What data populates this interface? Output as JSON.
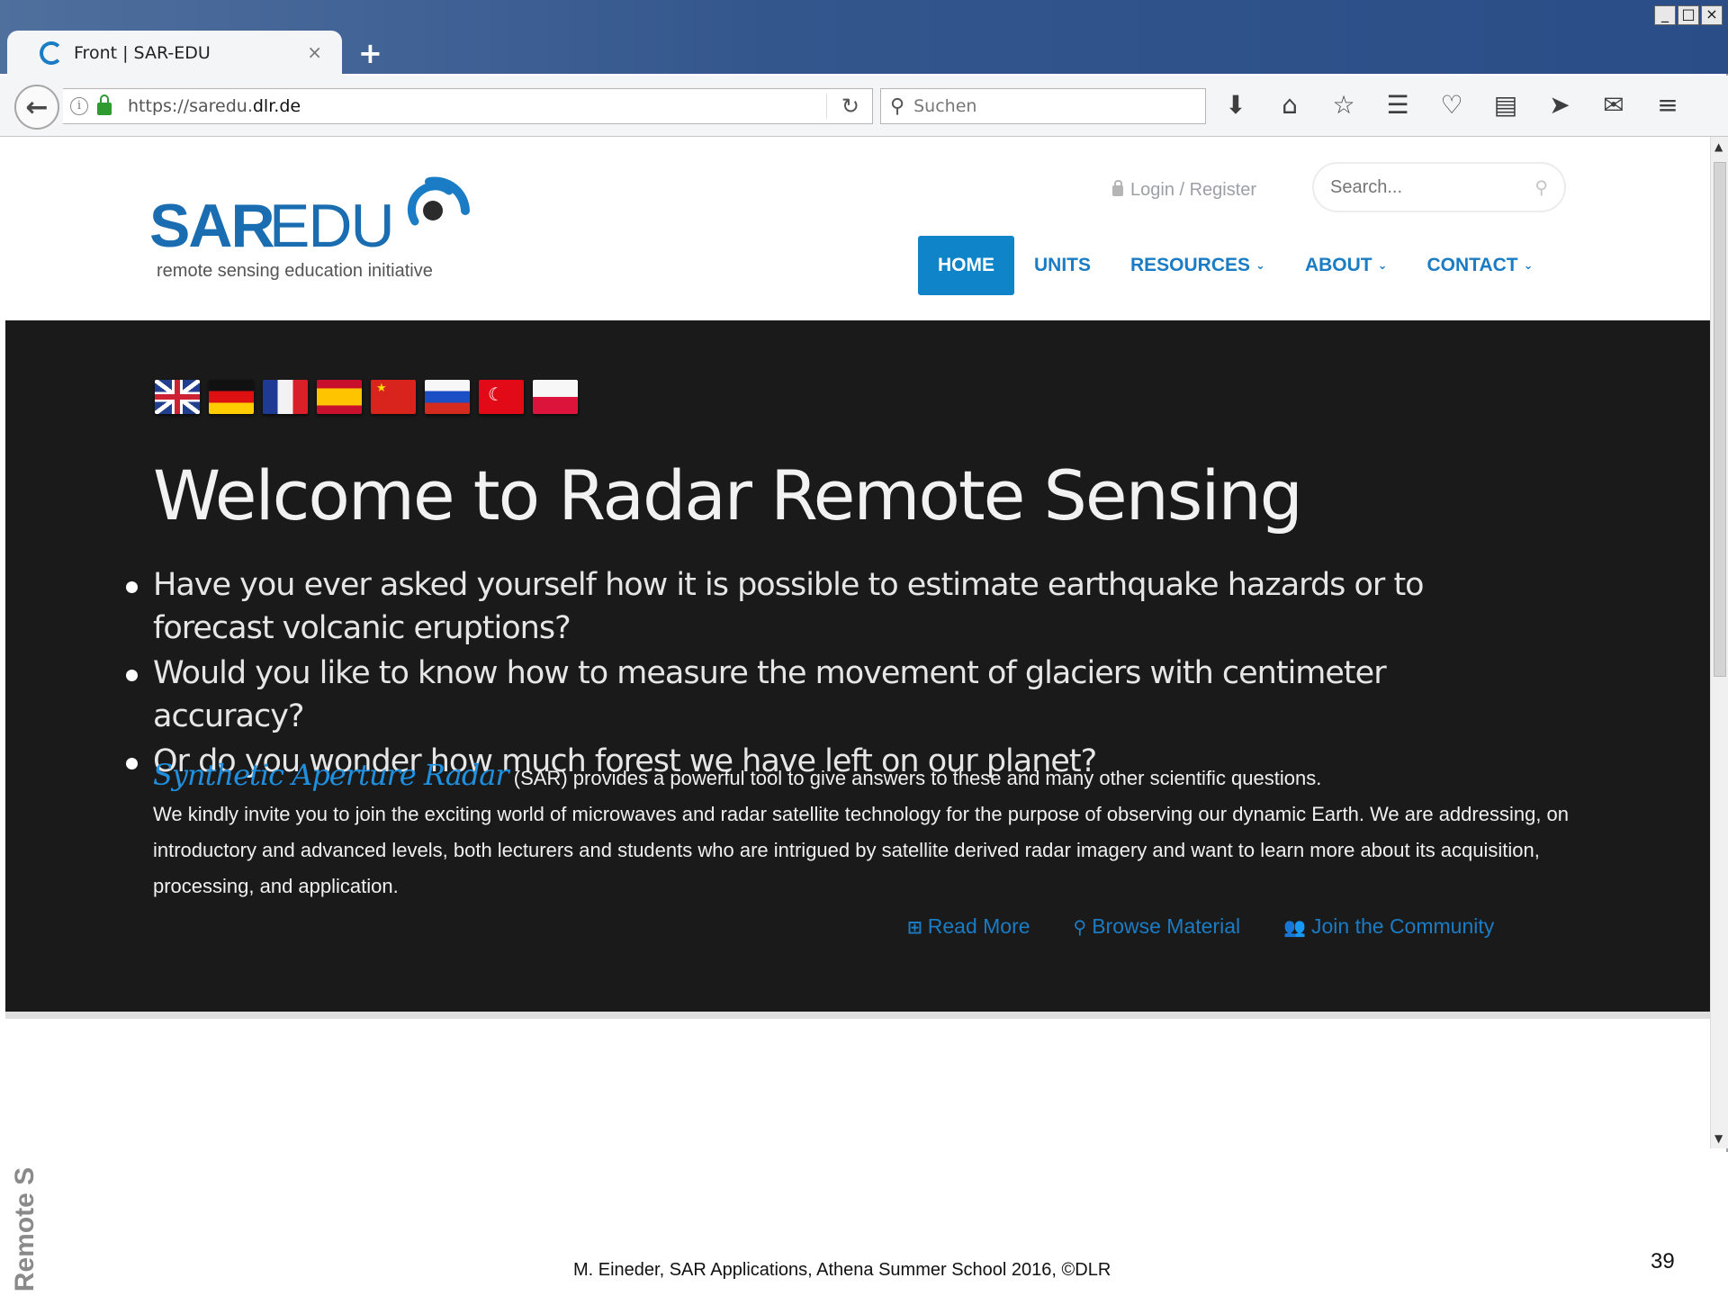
{
  "browser": {
    "tab_title": "Front | SAR-EDU",
    "tab_close": "×",
    "new_tab": "+",
    "url_prefix": "https://saredu.",
    "url_domain": "dlr.de",
    "search_placeholder": "Suchen",
    "window_controls": [
      "_",
      "□",
      "×"
    ],
    "toolbar_icons": [
      "download-icon",
      "home-icon",
      "bookmark-star-icon",
      "reading-list-icon",
      "pocket-icon",
      "pdf-icon",
      "send-icon",
      "chat-icon",
      "menu-icon"
    ]
  },
  "site": {
    "logo_sar": "SAR",
    "logo_edu": "EDU",
    "tagline": "remote sensing education initiative",
    "login": "Login / Register",
    "search_placeholder": "Search...",
    "nav": [
      {
        "label": "HOME",
        "active": true
      },
      {
        "label": "UNITS",
        "active": false
      },
      {
        "label": "RESOURCES",
        "active": false,
        "dropdown": true
      },
      {
        "label": "ABOUT",
        "active": false,
        "dropdown": true
      },
      {
        "label": "CONTACT",
        "active": false,
        "dropdown": true
      }
    ],
    "accent_color": "#0f84c9"
  },
  "hero": {
    "flags": [
      "flag-uk",
      "flag-germany",
      "flag-france",
      "flag-spain",
      "flag-china",
      "flag-russia",
      "flag-turkey",
      "flag-poland"
    ],
    "title": "Welcome to Radar Remote Sensing",
    "bullets": [
      "Have you ever asked yourself how it is possible to estimate earthquake hazards or to forecast volcanic eruptions?",
      "Would you like to know how to measure the movement of glaciers with centimeter accuracy?",
      "Or do you wonder how much forest we have left on our planet?"
    ],
    "sar_script": "Synthetic Aperture Radar",
    "sar_sentence": " (SAR) provides a powerful tool to give answers to these and many other scientific questions.",
    "invite": "We kindly invite you to join the exciting world of microwaves and radar satellite technology for the purpose of observing our dynamic Earth. We are addressing, on introductory and advanced levels, both lecturers and students who are intrigued by satellite derived radar imagery and want to learn more about its acquisition, processing, and application.",
    "actions": [
      {
        "label": "Read More",
        "icon": "plus-square-icon"
      },
      {
        "label": "Browse Material",
        "icon": "search-icon"
      },
      {
        "label": "Join the Community",
        "icon": "users-icon"
      }
    ]
  },
  "slide": {
    "side_label": "Remote S",
    "footer": "M. Eineder, SAR Applications, Athena Summer School 2016, ©DLR",
    "page_number": "39"
  }
}
